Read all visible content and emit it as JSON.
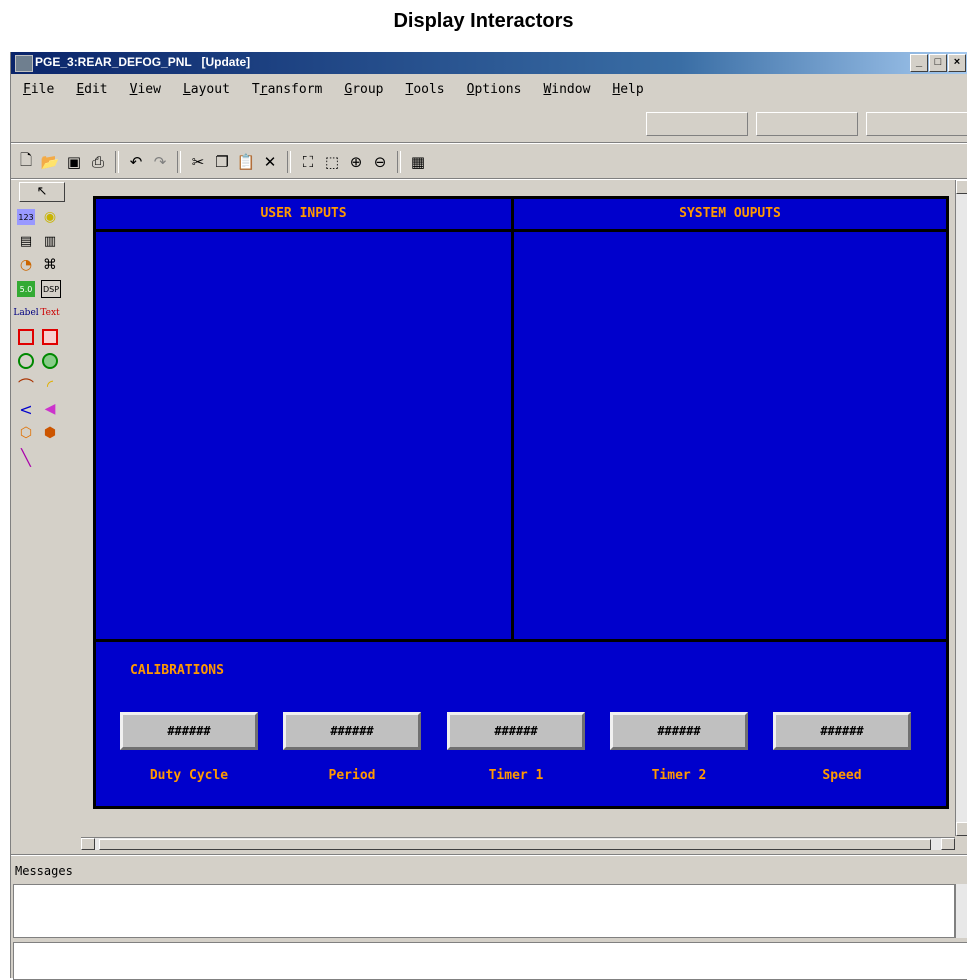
{
  "page_title": "Display Interactors",
  "window": {
    "title": "PGE_3:REAR_DEFOG_PNL   [Update]",
    "controls": [
      "_",
      "□",
      "×"
    ]
  },
  "menu": [
    {
      "label": "File",
      "key": "F"
    },
    {
      "label": "Edit",
      "key": "E"
    },
    {
      "label": "View",
      "key": "V"
    },
    {
      "label": "Layout",
      "key": "L"
    },
    {
      "label": "Transform",
      "key": "r"
    },
    {
      "label": "Group",
      "key": "G"
    },
    {
      "label": "Tools",
      "key": "T"
    },
    {
      "label": "Options",
      "key": "O"
    },
    {
      "label": "Window",
      "key": "W"
    },
    {
      "label": "Help",
      "key": "H"
    }
  ],
  "toolbar": [
    "new-icon",
    "open-icon",
    "save-icon",
    "print-icon",
    "undo-icon",
    "redo-icon",
    "cut-icon",
    "copy-icon",
    "paste-icon",
    "delete-icon",
    "fit-icon",
    "zoom-area-icon",
    "zoom-in-icon",
    "zoom-out-icon",
    "grid-icon"
  ],
  "palette": {
    "label_text": "Label",
    "text_text": "Text"
  },
  "panel": {
    "user_inputs": "USER INPUTS",
    "system_outputs": "SYSTEM OUPUTS",
    "calibrations_title": "CALIBRATIONS",
    "calibrations": [
      {
        "value": "######",
        "label": "Duty Cycle"
      },
      {
        "value": "######",
        "label": "Period"
      },
      {
        "value": "######",
        "label": "Timer 1"
      },
      {
        "value": "######",
        "label": "Timer 2"
      },
      {
        "value": "######",
        "label": "Speed"
      }
    ],
    "colors": {
      "background": "#0000cc",
      "text": "#ff9900"
    }
  },
  "messages_label": "Messages"
}
